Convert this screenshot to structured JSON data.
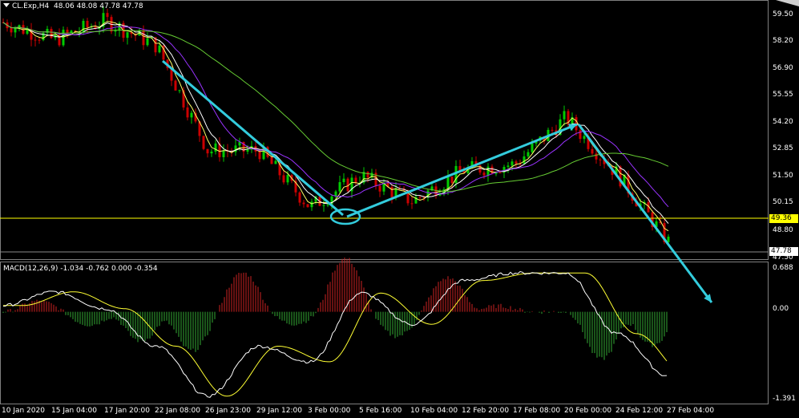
{
  "header": {
    "symbol_menu_icon": "triangle-down-icon",
    "instrument": "CL.Exp,H4",
    "ohlc": "48.06 48.08 47.78 47.78",
    "corner_icon": "triangle-corner-icon"
  },
  "indicator": {
    "label": "MACD(12,26,9) -1.034 -0.762 0.000 -0.354",
    "axis_ticks": [
      "0.688",
      "0.00",
      "-1.391"
    ]
  },
  "price_axis": {
    "ticks": [
      "59.50",
      "58.20",
      "56.90",
      "55.55",
      "54.20",
      "52.85",
      "51.50",
      "50.15",
      "48.80",
      "47.50"
    ],
    "reference_line_value": "49.36",
    "current_price_value": "47.78"
  },
  "time_axis": {
    "ticks": [
      "10 Jan 2020",
      "15 Jan 04:00",
      "17 Jan 20:00",
      "22 Jan 08:00",
      "26 Jan 23:00",
      "29 Jan 12:00",
      "3 Feb 00:00",
      "5 Feb 16:00",
      "10 Feb 04:00",
      "12 Feb 20:00",
      "17 Feb 08:00",
      "20 Feb 00:00",
      "24 Feb 12:00",
      "27 Feb 04:00"
    ]
  },
  "colors": {
    "background": "#000000",
    "bull_candle": "#00cc00",
    "bear_candle": "#cc0000",
    "ma_fast": "#ffff66",
    "ma_mid": "#ffffff",
    "ma_slow": "#9933ff",
    "ma_long": "#66cc33",
    "reference_line": "#ffff00",
    "annotation": "#33ccdd",
    "macd_line": "#ffffff",
    "signal_line": "#ffff33",
    "hist_pos": "#cc2222",
    "hist_neg": "#33aa33"
  },
  "chart_data": [
    {
      "type": "candlestick",
      "title": "CL.Exp,H4",
      "ylim": [
        47.2,
        60.0
      ],
      "x": [
        "10 Jan 2020",
        "15 Jan 04:00",
        "17 Jan 20:00",
        "22 Jan 08:00",
        "26 Jan 23:00",
        "29 Jan 12:00",
        "3 Feb 00:00",
        "5 Feb 16:00",
        "10 Feb 04:00",
        "12 Feb 20:00",
        "17 Feb 08:00",
        "20 Feb 00:00",
        "24 Feb 12:00",
        "27 Feb 04:00"
      ],
      "series": [
        {
          "name": "",
          "values": [
            59.1,
            58.2,
            59.2,
            57.9,
            52.5,
            52.5,
            49.6,
            51.2,
            49.9,
            51.5,
            51.8,
            54.2,
            51.3,
            47.8
          ]
        }
      ]
    },
    {
      "type": "bar",
      "title": "MACD(12,26,9)",
      "ylim": [
        -1.391,
        0.688
      ],
      "series": [
        {
          "name": "",
          "values": [
            0.1,
            0.32,
            0.05,
            -0.55,
            -1.35,
            -0.55,
            -0.8,
            0.3,
            -0.2,
            0.5,
            0.62,
            0.62,
            -0.35,
            -1.03
          ]
        }
      ]
    }
  ]
}
